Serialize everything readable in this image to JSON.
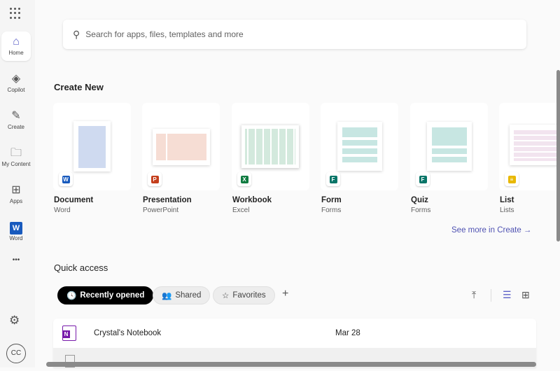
{
  "sidebar": {
    "items": [
      {
        "label": "Home",
        "icon": "home-icon",
        "active": true
      },
      {
        "label": "Copilot",
        "icon": "copilot-icon"
      },
      {
        "label": "Create",
        "icon": "pen-icon"
      },
      {
        "label": "My Content",
        "icon": "folder-icon"
      },
      {
        "label": "Apps",
        "icon": "apps-icon"
      },
      {
        "label": "Word",
        "icon": "word-icon"
      }
    ],
    "more": "•••",
    "avatar": "CC"
  },
  "search": {
    "placeholder": "Search for apps, files, templates and more"
  },
  "create": {
    "title": "Create New",
    "cards": [
      {
        "title": "Document",
        "app": "Word",
        "color": "#185abd",
        "letter": "W"
      },
      {
        "title": "Presentation",
        "app": "PowerPoint",
        "color": "#c43e1c",
        "letter": "P"
      },
      {
        "title": "Workbook",
        "app": "Excel",
        "color": "#107c41",
        "letter": "X"
      },
      {
        "title": "Form",
        "app": "Forms",
        "color": "#077568",
        "letter": "F"
      },
      {
        "title": "Quiz",
        "app": "Forms",
        "color": "#077568",
        "letter": "F"
      },
      {
        "title": "List",
        "app": "Lists",
        "color": "#c8a400",
        "letter": "≡"
      }
    ],
    "see_more": "See more in Create →"
  },
  "quick": {
    "title": "Quick access",
    "filters": [
      "Recently opened",
      "Shared",
      "Favorites"
    ],
    "add": "+",
    "files": [
      {
        "name": "Crystal's Notebook",
        "date": "Mar 28",
        "app": "OneNote",
        "color": "#7719aa"
      }
    ]
  }
}
